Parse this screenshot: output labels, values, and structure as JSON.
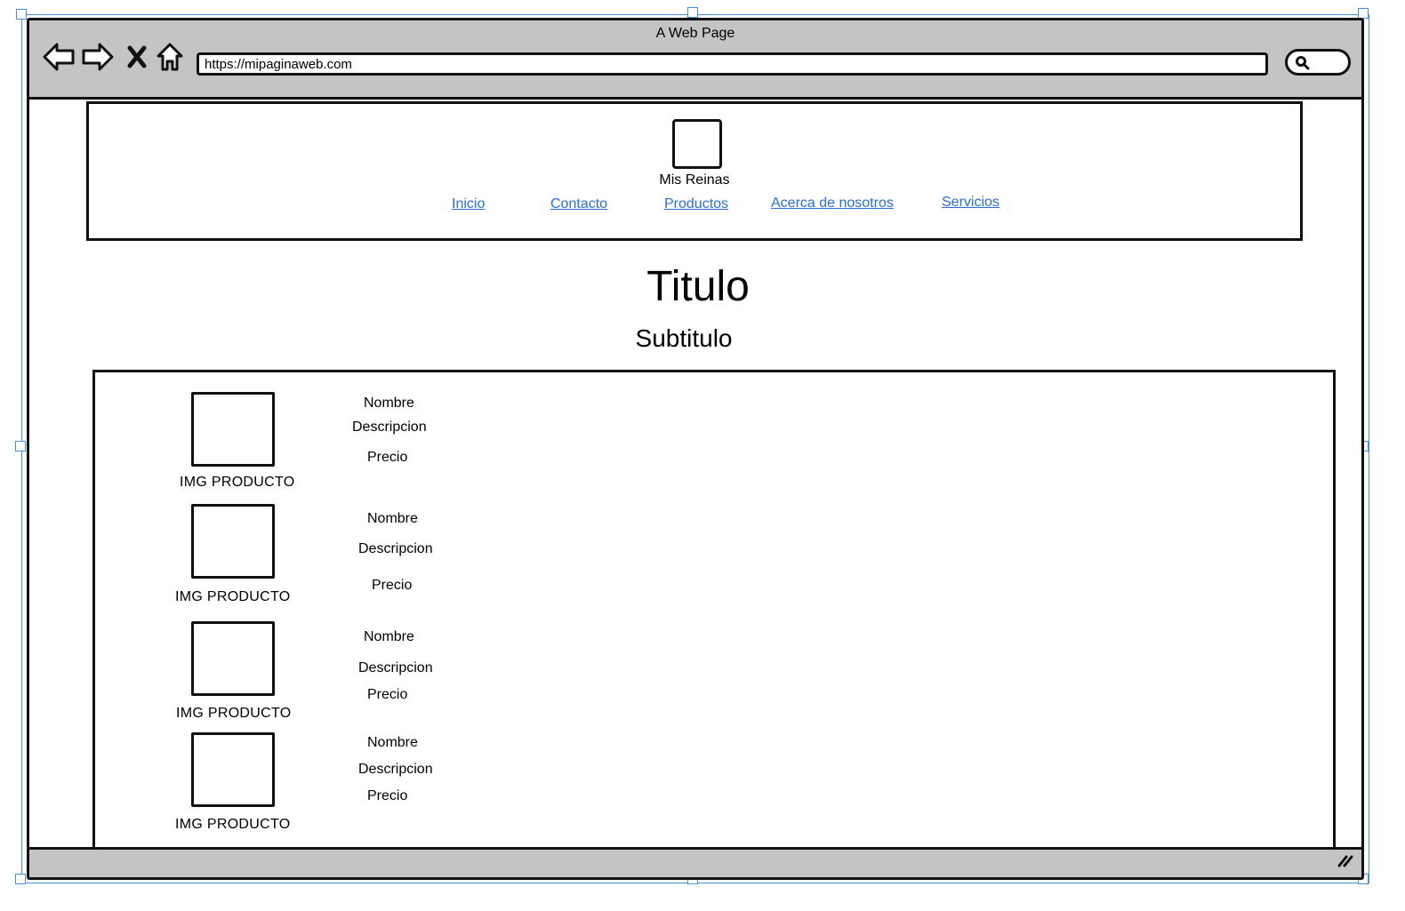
{
  "window": {
    "title": "A Web Page"
  },
  "address_bar": {
    "url": "https://mipaginaweb.com"
  },
  "header": {
    "brand": "Mis Reinas",
    "nav": [
      "Inicio",
      "Contacto",
      "Productos",
      "Acerca de nosotros",
      "Servicios"
    ]
  },
  "main": {
    "title": "Titulo",
    "subtitle": "Subtitulo",
    "products": [
      {
        "image_label": "IMG PRODUCTO",
        "name": "Nombre",
        "description": "Descripcion",
        "price": "Precio"
      },
      {
        "image_label": "IMG PRODUCTO",
        "name": "Nombre",
        "description": "Descripcion",
        "price": "Precio"
      },
      {
        "image_label": "IMG PRODUCTO",
        "name": "Nombre",
        "description": "Descripcion",
        "price": "Precio"
      },
      {
        "image_label": "IMG PRODUCTO",
        "name": "Nombre",
        "description": "Descripcion",
        "price": "Precio"
      }
    ]
  },
  "colors": {
    "link": "#2a6ed6",
    "chrome": "#c4c4c4",
    "selection": "#4a90d9"
  },
  "icons": [
    "back-arrow-icon",
    "forward-arrow-icon",
    "close-icon",
    "home-icon",
    "search-icon",
    "resize-grip-icon"
  ]
}
